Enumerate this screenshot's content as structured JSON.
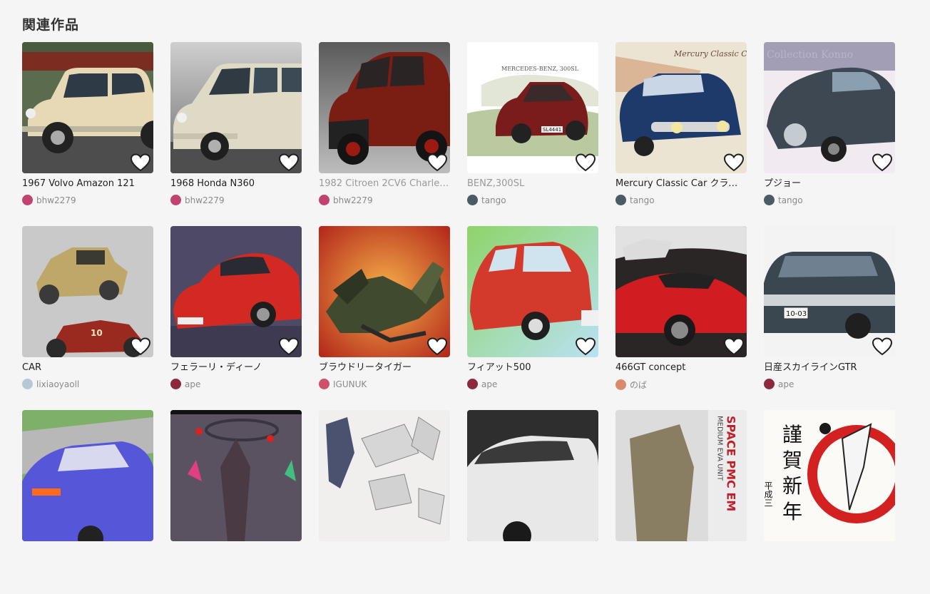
{
  "section": {
    "title": "関連作品"
  },
  "colors": {
    "background": "#f5f5f5",
    "heart_fill": "#ffffff",
    "heart_stroke": "#1f1f1f"
  },
  "works": [
    {
      "title": "1967 Volvo Amazon 121",
      "author": "bhw2279",
      "title_muted": false,
      "avatar_color": "#c0446f"
    },
    {
      "title": "1968 Honda N360",
      "author": "bhw2279",
      "title_muted": false,
      "avatar_color": "#c0446f"
    },
    {
      "title": "1982 Citroen 2CV6 Charlest…",
      "author": "bhw2279",
      "title_muted": true,
      "avatar_color": "#c0446f"
    },
    {
      "title": "BENZ,300SL",
      "author": "tango",
      "title_muted": true,
      "avatar_color": "#4a5a66"
    },
    {
      "title": "Mercury Classic Car クラシッ…",
      "author": "tango",
      "title_muted": false,
      "avatar_color": "#4a5a66"
    },
    {
      "title": "プジョー",
      "author": "tango",
      "title_muted": false,
      "avatar_color": "#4a5a66"
    },
    {
      "title": "CAR",
      "author": "lixiaoyaoll",
      "title_muted": false,
      "avatar_color": "#b7c7d6"
    },
    {
      "title": "フェラーリ・ディーノ",
      "author": "ape",
      "title_muted": false,
      "avatar_color": "#8a2a3a"
    },
    {
      "title": "ブラウドリータイガー",
      "author": "IGUNUK",
      "title_muted": false,
      "avatar_color": "#d0506a"
    },
    {
      "title": "フィアット500",
      "author": "ape",
      "title_muted": false,
      "avatar_color": "#8a2a3a"
    },
    {
      "title": "466GT concept",
      "author": "のば",
      "title_muted": false,
      "avatar_color": "#d98a6a"
    },
    {
      "title": "日産スカイラインGTR",
      "author": "ape",
      "title_muted": false,
      "avatar_color": "#8a2a3a"
    },
    {
      "title": "",
      "author": "",
      "title_muted": false,
      "avatar_color": "#cccccc"
    },
    {
      "title": "",
      "author": "",
      "title_muted": false,
      "avatar_color": "#cccccc"
    },
    {
      "title": "",
      "author": "",
      "title_muted": false,
      "avatar_color": "#cccccc"
    },
    {
      "title": "",
      "author": "",
      "title_muted": false,
      "avatar_color": "#cccccc"
    },
    {
      "title": "",
      "author": "",
      "title_muted": false,
      "avatar_color": "#cccccc"
    },
    {
      "title": "",
      "author": "",
      "title_muted": false,
      "avatar_color": "#cccccc"
    }
  ],
  "thumb_texts": {
    "benz_caption": "MERCEDES-BENZ, 300SL",
    "benz_plate": "SL4441",
    "mercury_script": "Mercury Classic C",
    "peugeot_script": "Collection Konno",
    "skyline_plate": "10-03",
    "fiat_plate": "",
    "space_pmc": "SPACE PMC EM",
    "medium_eva": "MEDIUM EVA UNIT",
    "kinga_1": "謹",
    "kinga_2": "賀",
    "kinga_3": "新",
    "kinga_4": "年",
    "heisei": "平成三"
  }
}
